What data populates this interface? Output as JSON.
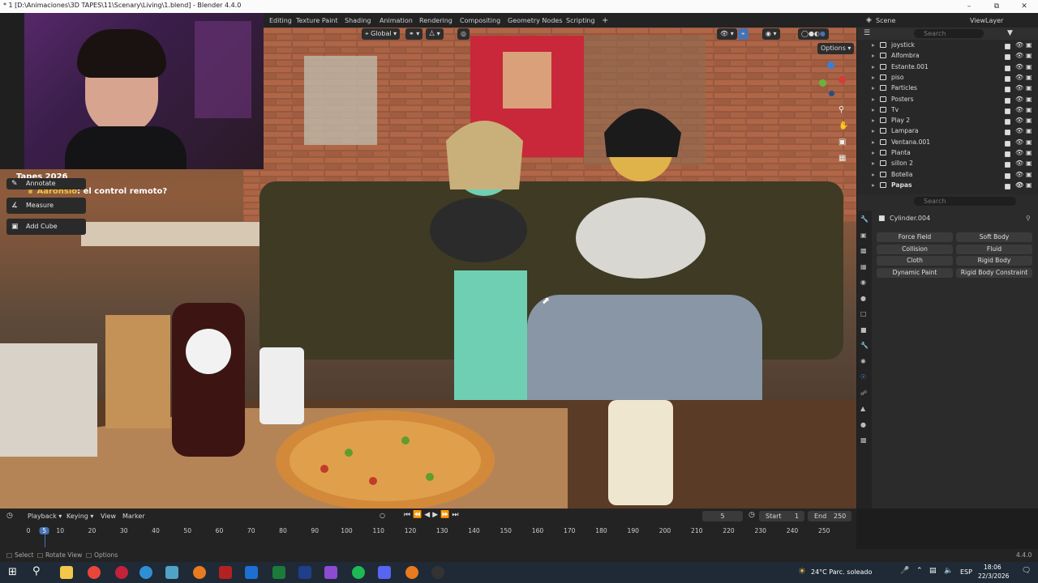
{
  "window": {
    "title": "* 1 [D:\\Animaciones\\3D TAPES\\11\\Scenary\\Living\\1.blend] - Blender 4.4.0"
  },
  "workspaces": [
    "Editing",
    "Texture Paint",
    "Shading",
    "Animation",
    "Rendering",
    "Compositing",
    "Geometry Nodes",
    "Scripting"
  ],
  "scene_label": "Scene",
  "viewlayer_label": "ViewLayer",
  "viewport": {
    "orientation": "Global",
    "options_label": "Options",
    "chat": {
      "stream_name": "Tapes 2026",
      "user": "Aaronsio",
      "message": "el control remoto?"
    }
  },
  "toolbar": {
    "annotate": "Annotate",
    "measure": "Measure",
    "add_cube": "Add Cube"
  },
  "outliner": {
    "search_placeholder": "Search",
    "items": [
      "joystick",
      "Alfombra",
      "Estante.001",
      "piso",
      "Particles",
      "Posters",
      "Tv",
      "Play 2",
      "Lampara",
      "Ventana.001",
      "Planta",
      "sillon 2",
      "Botella",
      "Papas"
    ]
  },
  "properties": {
    "search_placeholder": "Search",
    "object_name": "Cylinder.004",
    "physics_buttons": [
      [
        "Force Field",
        "Soft Body"
      ],
      [
        "Collision",
        "Fluid"
      ],
      [
        "Cloth",
        "Rigid Body"
      ],
      [
        "Dynamic Paint",
        "Rigid Body Constraint"
      ]
    ]
  },
  "timeline": {
    "playback": "Playback",
    "keying": "Keying",
    "view": "View",
    "marker": "Marker",
    "current_frame": "5",
    "start_label": "Start",
    "start": "1",
    "end_label": "End",
    "end": "250",
    "ruler": [
      "0",
      "5",
      "10",
      "20",
      "30",
      "40",
      "50",
      "60",
      "70",
      "80",
      "90",
      "100",
      "110",
      "120",
      "130",
      "140",
      "150",
      "160",
      "170",
      "180",
      "190",
      "200",
      "210",
      "220",
      "230",
      "240",
      "250"
    ]
  },
  "statusbar": {
    "select": "Select",
    "rotate": "Rotate View",
    "options": "Options",
    "version": "4.4.0"
  },
  "taskbar": {
    "weather": "24°C  Parc. soleado",
    "lang": "ESP",
    "time": "18:06",
    "date": "22/3/2026"
  }
}
